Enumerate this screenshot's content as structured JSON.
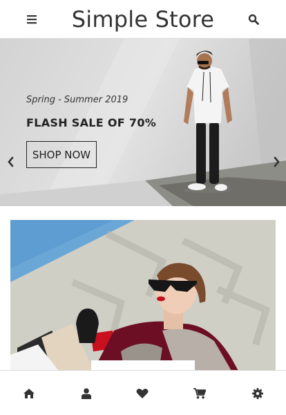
{
  "header": {
    "brand": "Simple Store",
    "menu_icon": "hamburger-menu-icon",
    "search_icon": "search-icon"
  },
  "hero": {
    "subtitle": "Spring - Summer 2019",
    "title": "FLASH SALE OF 70%",
    "cta_label": "SHOP NOW",
    "prev_icon": "chevron-left-icon",
    "next_icon": "chevron-right-icon"
  },
  "bottom_nav": {
    "items": [
      {
        "icon": "home-icon"
      },
      {
        "icon": "user-icon"
      },
      {
        "icon": "heart-icon"
      },
      {
        "icon": "cart-icon"
      },
      {
        "icon": "gear-icon"
      }
    ]
  },
  "colors": {
    "text": "#333333",
    "border": "#d9d9d9",
    "hero_bg": "#dcdcdc",
    "sky": "#6aa7d6"
  }
}
